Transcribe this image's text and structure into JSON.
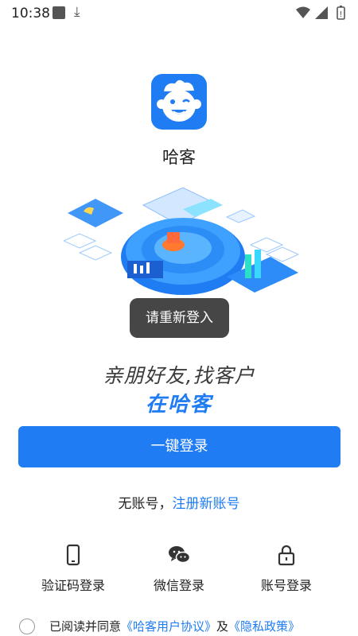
{
  "status_bar": {
    "time": "10:38"
  },
  "app": {
    "name": "哈客"
  },
  "toast": {
    "text": "请重新登入"
  },
  "slogan": {
    "line1": "亲朋好友,找客户",
    "line2": "在哈客"
  },
  "primary_button": {
    "label": "一键登录"
  },
  "register": {
    "prefix": "无账号，",
    "link": "注册新账号"
  },
  "login_methods": [
    {
      "label": "验证码登录",
      "icon": "phone-icon"
    },
    {
      "label": "微信登录",
      "icon": "wechat-icon"
    },
    {
      "label": "账号登录",
      "icon": "lock-icon"
    }
  ],
  "agreement": {
    "prefix": "已阅读并同意",
    "user_agreement": "《哈客用户协议》",
    "conjunction": "及",
    "privacy_policy": "《隐私政策》"
  },
  "colors": {
    "accent": "#1f7cf2",
    "text": "#222222",
    "toast_bg": "#282828"
  }
}
